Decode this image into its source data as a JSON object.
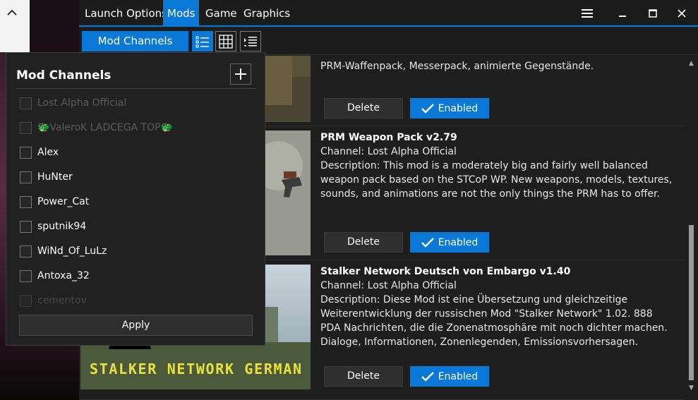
{
  "menu": {
    "items": [
      {
        "label": "Launch Options"
      },
      {
        "label": "Mods"
      },
      {
        "label": "Game"
      },
      {
        "label": "Graphics"
      }
    ]
  },
  "toolbar": {
    "channels_label": "Mod Channels"
  },
  "mods": [
    {
      "description": "PRM-Waffenpack, Messerpack, animierte Gegenstände.",
      "delete_label": "Delete",
      "enabled_label": "Enabled"
    },
    {
      "title": "PRM Weapon Pack v2.79",
      "channel": "Channel: Lost Alpha Official",
      "description": "Description: This mod is a moderately big and fairly well balanced weapon pack based on the STCoP WP. New weapons, models, textures, sounds, and animations are not the only things the PRM has to offer.",
      "delete_label": "Delete",
      "enabled_label": "Enabled"
    },
    {
      "title": "Stalker Network Deutsch von Embargo v1.40",
      "channel": "Channel: Lost Alpha Official",
      "description": "Description: Diese Mod ist eine Übersetzung und gleichzeitige Weiterentwicklung der russischen Mod \"Stalker Network\" 1.02.  888 PDA Nachrichten, die die Zonenatmosphäre mit noch dichter machen. Dialoge, Informationen, Zonenlegenden, Emissionsvorhersagen.",
      "image_text": "STALKER NETWORK GERMAN",
      "delete_label": "Delete",
      "enabled_label": "Enabled"
    }
  ],
  "popup": {
    "title": "Mod Channels",
    "channels": [
      {
        "label": "Lost Alpha Official",
        "checked": false,
        "state": "disabled"
      },
      {
        "label": "🐲ValeroK LADCEGA TOP🐲",
        "checked": false,
        "state": "disabled"
      },
      {
        "label": "Alex",
        "checked": false,
        "state": "normal"
      },
      {
        "label": "HuNter",
        "checked": false,
        "state": "normal"
      },
      {
        "label": "Power_Cat",
        "checked": false,
        "state": "normal"
      },
      {
        "label": "sputnik94",
        "checked": false,
        "state": "normal"
      },
      {
        "label": "WiNd_Of_LuLz",
        "checked": false,
        "state": "normal"
      },
      {
        "label": "Antoxa_32",
        "checked": false,
        "state": "normal"
      },
      {
        "label": "cementov",
        "checked": false,
        "state": "faded"
      }
    ],
    "apply_label": "Apply"
  },
  "colors": {
    "accent": "#0a78d7",
    "window_bg": "#1e1e1e",
    "popup_bg": "#212121"
  }
}
